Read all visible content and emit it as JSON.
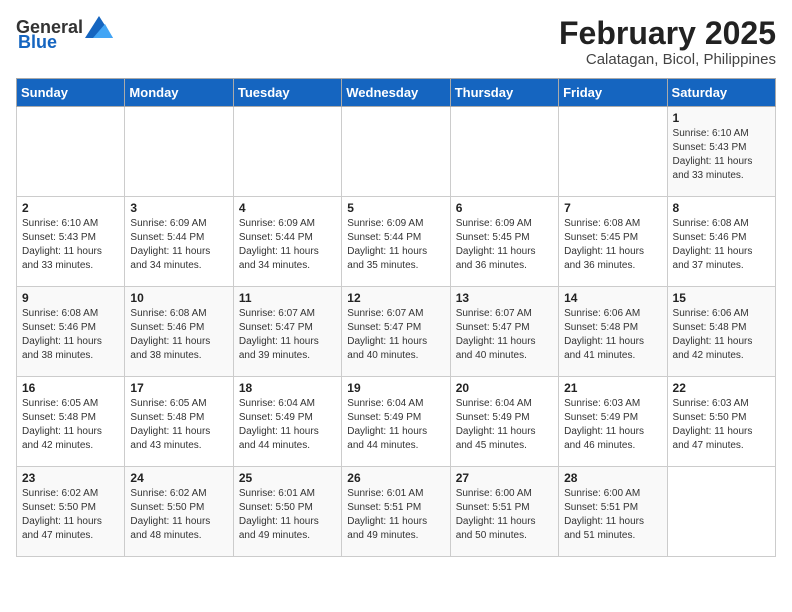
{
  "header": {
    "logo_general": "General",
    "logo_blue": "Blue",
    "month_year": "February 2025",
    "location": "Calatagan, Bicol, Philippines"
  },
  "weekdays": [
    "Sunday",
    "Monday",
    "Tuesday",
    "Wednesday",
    "Thursday",
    "Friday",
    "Saturday"
  ],
  "weeks": [
    [
      {
        "day": "",
        "info": ""
      },
      {
        "day": "",
        "info": ""
      },
      {
        "day": "",
        "info": ""
      },
      {
        "day": "",
        "info": ""
      },
      {
        "day": "",
        "info": ""
      },
      {
        "day": "",
        "info": ""
      },
      {
        "day": "1",
        "info": "Sunrise: 6:10 AM\nSunset: 5:43 PM\nDaylight: 11 hours\nand 33 minutes."
      }
    ],
    [
      {
        "day": "2",
        "info": "Sunrise: 6:10 AM\nSunset: 5:43 PM\nDaylight: 11 hours\nand 33 minutes."
      },
      {
        "day": "3",
        "info": "Sunrise: 6:09 AM\nSunset: 5:44 PM\nDaylight: 11 hours\nand 34 minutes."
      },
      {
        "day": "4",
        "info": "Sunrise: 6:09 AM\nSunset: 5:44 PM\nDaylight: 11 hours\nand 34 minutes."
      },
      {
        "day": "5",
        "info": "Sunrise: 6:09 AM\nSunset: 5:44 PM\nDaylight: 11 hours\nand 35 minutes."
      },
      {
        "day": "6",
        "info": "Sunrise: 6:09 AM\nSunset: 5:45 PM\nDaylight: 11 hours\nand 36 minutes."
      },
      {
        "day": "7",
        "info": "Sunrise: 6:08 AM\nSunset: 5:45 PM\nDaylight: 11 hours\nand 36 minutes."
      },
      {
        "day": "8",
        "info": "Sunrise: 6:08 AM\nSunset: 5:46 PM\nDaylight: 11 hours\nand 37 minutes."
      }
    ],
    [
      {
        "day": "9",
        "info": "Sunrise: 6:08 AM\nSunset: 5:46 PM\nDaylight: 11 hours\nand 38 minutes."
      },
      {
        "day": "10",
        "info": "Sunrise: 6:08 AM\nSunset: 5:46 PM\nDaylight: 11 hours\nand 38 minutes."
      },
      {
        "day": "11",
        "info": "Sunrise: 6:07 AM\nSunset: 5:47 PM\nDaylight: 11 hours\nand 39 minutes."
      },
      {
        "day": "12",
        "info": "Sunrise: 6:07 AM\nSunset: 5:47 PM\nDaylight: 11 hours\nand 40 minutes."
      },
      {
        "day": "13",
        "info": "Sunrise: 6:07 AM\nSunset: 5:47 PM\nDaylight: 11 hours\nand 40 minutes."
      },
      {
        "day": "14",
        "info": "Sunrise: 6:06 AM\nSunset: 5:48 PM\nDaylight: 11 hours\nand 41 minutes."
      },
      {
        "day": "15",
        "info": "Sunrise: 6:06 AM\nSunset: 5:48 PM\nDaylight: 11 hours\nand 42 minutes."
      }
    ],
    [
      {
        "day": "16",
        "info": "Sunrise: 6:05 AM\nSunset: 5:48 PM\nDaylight: 11 hours\nand 42 minutes."
      },
      {
        "day": "17",
        "info": "Sunrise: 6:05 AM\nSunset: 5:48 PM\nDaylight: 11 hours\nand 43 minutes."
      },
      {
        "day": "18",
        "info": "Sunrise: 6:04 AM\nSunset: 5:49 PM\nDaylight: 11 hours\nand 44 minutes."
      },
      {
        "day": "19",
        "info": "Sunrise: 6:04 AM\nSunset: 5:49 PM\nDaylight: 11 hours\nand 44 minutes."
      },
      {
        "day": "20",
        "info": "Sunrise: 6:04 AM\nSunset: 5:49 PM\nDaylight: 11 hours\nand 45 minutes."
      },
      {
        "day": "21",
        "info": "Sunrise: 6:03 AM\nSunset: 5:49 PM\nDaylight: 11 hours\nand 46 minutes."
      },
      {
        "day": "22",
        "info": "Sunrise: 6:03 AM\nSunset: 5:50 PM\nDaylight: 11 hours\nand 47 minutes."
      }
    ],
    [
      {
        "day": "23",
        "info": "Sunrise: 6:02 AM\nSunset: 5:50 PM\nDaylight: 11 hours\nand 47 minutes."
      },
      {
        "day": "24",
        "info": "Sunrise: 6:02 AM\nSunset: 5:50 PM\nDaylight: 11 hours\nand 48 minutes."
      },
      {
        "day": "25",
        "info": "Sunrise: 6:01 AM\nSunset: 5:50 PM\nDaylight: 11 hours\nand 49 minutes."
      },
      {
        "day": "26",
        "info": "Sunrise: 6:01 AM\nSunset: 5:51 PM\nDaylight: 11 hours\nand 49 minutes."
      },
      {
        "day": "27",
        "info": "Sunrise: 6:00 AM\nSunset: 5:51 PM\nDaylight: 11 hours\nand 50 minutes."
      },
      {
        "day": "28",
        "info": "Sunrise: 6:00 AM\nSunset: 5:51 PM\nDaylight: 11 hours\nand 51 minutes."
      },
      {
        "day": "",
        "info": ""
      }
    ]
  ]
}
